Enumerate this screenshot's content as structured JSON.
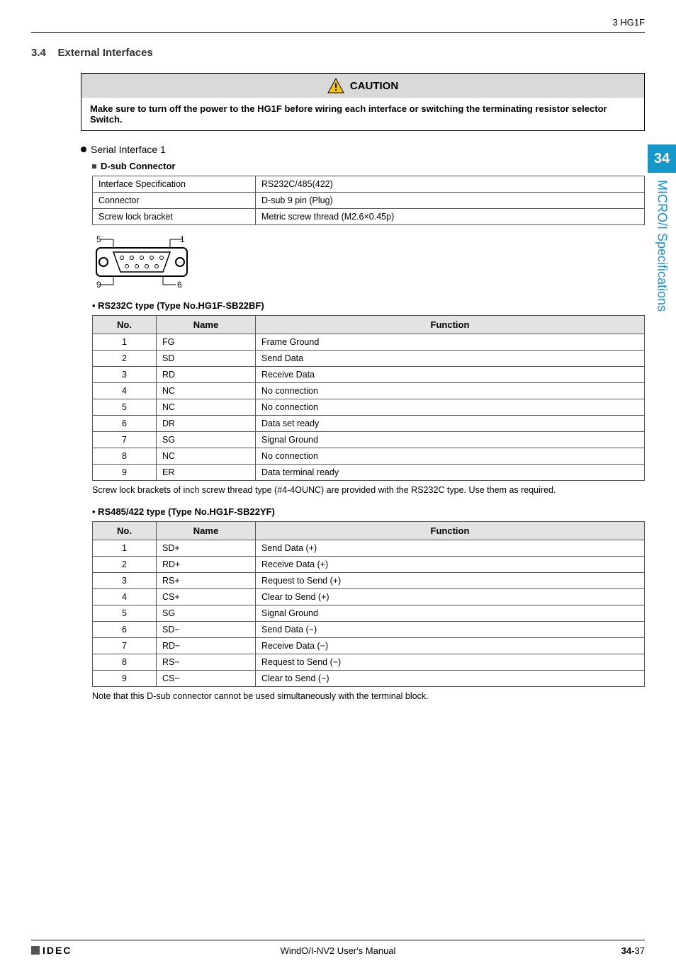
{
  "header": {
    "right": "3 HG1F"
  },
  "section": {
    "number": "3.4",
    "title": "External Interfaces"
  },
  "caution": {
    "label": "CAUTION",
    "body": "Make sure to turn off the power to the HG1F before wiring each interface or switching the terminating resistor selector Switch."
  },
  "serial1": {
    "title": "Serial Interface 1",
    "dsub_label": "D-sub Connector",
    "spec_rows": [
      {
        "k": "Interface Specification",
        "v": "RS232C/485(422)"
      },
      {
        "k": "Connector",
        "v": "D-sub 9 pin (Plug)"
      },
      {
        "k": "Screw lock bracket",
        "v": "Metric screw thread (M2.6×0.45p)"
      }
    ],
    "diagram_labels": {
      "tl": "5",
      "tr": "1",
      "bl": "9",
      "br": "6"
    }
  },
  "rs232c": {
    "heading": "• RS232C type (Type No.HG1F-SB22BF)",
    "headers": {
      "no": "No.",
      "name": "Name",
      "fn": "Function"
    },
    "rows": [
      {
        "no": "1",
        "name": "FG",
        "fn": "Frame Ground"
      },
      {
        "no": "2",
        "name": "SD",
        "fn": "Send Data"
      },
      {
        "no": "3",
        "name": "RD",
        "fn": "Receive Data"
      },
      {
        "no": "4",
        "name": "NC",
        "fn": "No connection"
      },
      {
        "no": "5",
        "name": "NC",
        "fn": "No connection"
      },
      {
        "no": "6",
        "name": "DR",
        "fn": "Data set ready"
      },
      {
        "no": "7",
        "name": "SG",
        "fn": "Signal Ground"
      },
      {
        "no": "8",
        "name": "NC",
        "fn": "No connection"
      },
      {
        "no": "9",
        "name": "ER",
        "fn": "Data terminal ready"
      }
    ],
    "note": "Screw lock brackets of inch screw thread type (#4-4OUNC) are provided with the RS232C type. Use them as required."
  },
  "rs485": {
    "heading": "• RS485/422 type (Type No.HG1F-SB22YF)",
    "headers": {
      "no": "No.",
      "name": "Name",
      "fn": "Function"
    },
    "rows": [
      {
        "no": "1",
        "name": "SD+",
        "fn": "Send Data (+)"
      },
      {
        "no": "2",
        "name": "RD+",
        "fn": "Receive Data (+)"
      },
      {
        "no": "3",
        "name": "RS+",
        "fn": "Request to Send (+)"
      },
      {
        "no": "4",
        "name": "CS+",
        "fn": "Clear to Send (+)"
      },
      {
        "no": "5",
        "name": "SG",
        "fn": "Signal Ground"
      },
      {
        "no": "6",
        "name": "SD−",
        "fn": "Send Data (−)"
      },
      {
        "no": "7",
        "name": "RD−",
        "fn": "Receive Data (−)"
      },
      {
        "no": "8",
        "name": "RS−",
        "fn": "Request to Send (−)"
      },
      {
        "no": "9",
        "name": "CS−",
        "fn": "Clear to Send (−)"
      }
    ],
    "note": "Note that this D-sub connector cannot be used simultaneously with the terminal block."
  },
  "side": {
    "chapter": "34",
    "label": "MICRO/I Specifications"
  },
  "footer": {
    "brand": "IDEC",
    "center": "WindO/I-NV2 User's Manual",
    "page_prefix": "34-",
    "page_num": "37"
  }
}
